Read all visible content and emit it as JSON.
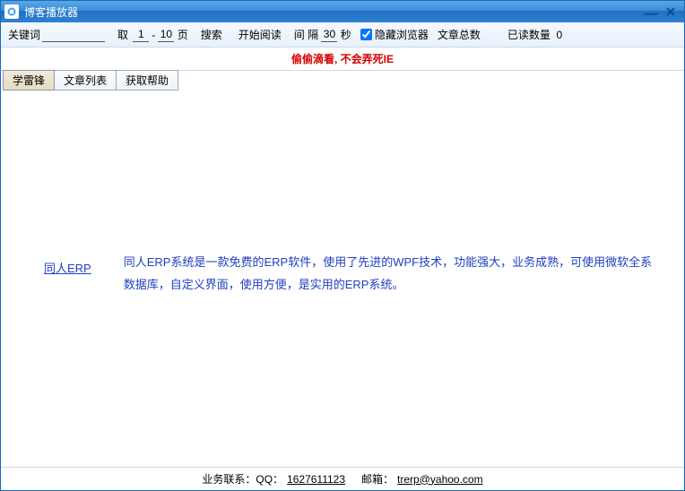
{
  "window": {
    "title": "博客播放器"
  },
  "toolbar": {
    "keyword_label": "关键词",
    "fetch_label": "取",
    "page_from": "1",
    "page_dash": "-",
    "page_to": "10",
    "page_suffix": "页",
    "search_btn": "搜索",
    "start_read_btn": "开始阅读",
    "interval_label": "间 隔",
    "interval_value": "30",
    "interval_suffix": "秒",
    "hide_browser_label": "隐藏浏览器",
    "hide_browser_checked": true,
    "article_total_label": "文章总数",
    "read_count_label": "已读数量",
    "read_count_value": "0"
  },
  "banner": {
    "text": "偷偷滴看, 不会弄死IE"
  },
  "tabs": [
    {
      "label": "学雷锋",
      "active": true
    },
    {
      "label": "文章列表",
      "active": false
    },
    {
      "label": "获取帮助",
      "active": false
    }
  ],
  "content": {
    "link_text": "同人ERP",
    "description": "同人ERP系统是一款免费的ERP软件，使用了先进的WPF技术，功能强大，业务成熟，可使用微软全系数据库，自定义界面，使用方便，是实用的ERP系统。"
  },
  "footer": {
    "contact_prefix": "业务联系：QQ：",
    "qq": "1627611123",
    "email_prefix": "邮箱：",
    "email": "trerp@yahoo.com"
  }
}
